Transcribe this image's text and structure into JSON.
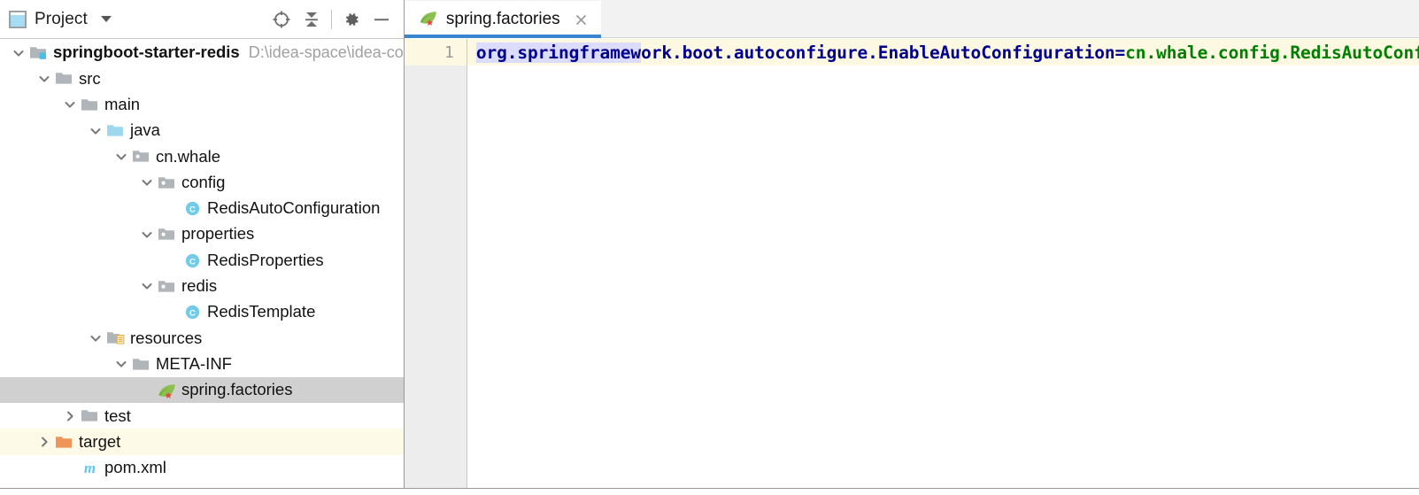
{
  "project_panel": {
    "title": "Project",
    "window_icon": "project-window-icon",
    "dropdown_icon": "chevron-down-icon",
    "actions": [
      {
        "name": "locate-icon",
        "label": "Select Opened File"
      },
      {
        "name": "collapse-all-icon",
        "label": "Collapse All"
      },
      {
        "name": "gear-icon",
        "label": "Settings"
      },
      {
        "name": "minimize-icon",
        "label": "Hide"
      }
    ],
    "tree": [
      {
        "label": "springboot-starter-redis",
        "path": "D:\\idea-space\\idea-co",
        "icon": "module-folder-icon",
        "indent": 0,
        "expanded": true,
        "bold": true,
        "state": "normal"
      },
      {
        "label": "src",
        "path": "",
        "icon": "folder-icon",
        "indent": 1,
        "expanded": true,
        "bold": false,
        "state": "normal"
      },
      {
        "label": "main",
        "path": "",
        "icon": "folder-icon",
        "indent": 2,
        "expanded": true,
        "bold": false,
        "state": "normal"
      },
      {
        "label": "java",
        "path": "",
        "icon": "source-folder-icon",
        "indent": 3,
        "expanded": true,
        "bold": false,
        "state": "normal"
      },
      {
        "label": "cn.whale",
        "path": "",
        "icon": "package-icon",
        "indent": 4,
        "expanded": true,
        "bold": false,
        "state": "normal"
      },
      {
        "label": "config",
        "path": "",
        "icon": "package-icon",
        "indent": 5,
        "expanded": true,
        "bold": false,
        "state": "normal"
      },
      {
        "label": "RedisAutoConfiguration",
        "path": "",
        "icon": "java-class-icon",
        "indent": 6,
        "expanded": null,
        "bold": false,
        "state": "normal"
      },
      {
        "label": "properties",
        "path": "",
        "icon": "package-icon",
        "indent": 5,
        "expanded": true,
        "bold": false,
        "state": "normal"
      },
      {
        "label": "RedisProperties",
        "path": "",
        "icon": "java-class-icon",
        "indent": 6,
        "expanded": null,
        "bold": false,
        "state": "normal"
      },
      {
        "label": "redis",
        "path": "",
        "icon": "package-icon",
        "indent": 5,
        "expanded": true,
        "bold": false,
        "state": "normal"
      },
      {
        "label": "RedisTemplate",
        "path": "",
        "icon": "java-class-icon",
        "indent": 6,
        "expanded": null,
        "bold": false,
        "state": "normal"
      },
      {
        "label": "resources",
        "path": "",
        "icon": "resources-folder-icon",
        "indent": 3,
        "expanded": true,
        "bold": false,
        "state": "normal"
      },
      {
        "label": "META-INF",
        "path": "",
        "icon": "folder-icon",
        "indent": 4,
        "expanded": true,
        "bold": false,
        "state": "normal"
      },
      {
        "label": "spring.factories",
        "path": "",
        "icon": "spring-leaf-icon",
        "indent": 5,
        "expanded": null,
        "bold": false,
        "state": "selected"
      },
      {
        "label": "test",
        "path": "",
        "icon": "folder-icon",
        "indent": 2,
        "expanded": false,
        "bold": false,
        "state": "normal"
      },
      {
        "label": "target",
        "path": "",
        "icon": "excluded-folder-icon",
        "indent": 1,
        "expanded": false,
        "bold": false,
        "state": "tinted"
      },
      {
        "label": "pom.xml",
        "path": "",
        "icon": "maven-icon",
        "indent": 2,
        "expanded": null,
        "bold": false,
        "state": "normal"
      }
    ]
  },
  "editor": {
    "tabs": [
      {
        "label": "spring.factories",
        "icon": "spring-leaf-icon",
        "active": true,
        "close_icon": "close-icon"
      }
    ],
    "line_numbers": [
      "1"
    ],
    "code": {
      "key_selected": "org.springframew",
      "key_rest": "ork.boot.autoconfigure.EnableAutoConfiguration",
      "equals": "=",
      "value": "cn.whale.config.RedisAutoConfiguration"
    }
  },
  "colors": {
    "accent": "#3a85d0",
    "code_key": "#00008f",
    "code_value": "#008000",
    "current_line": "#fdf8e1",
    "selection": "#dcdcff",
    "row_selected": "#d0d0d0",
    "row_tinted": "#fdfbe8",
    "source_folder": "#9ed8f0",
    "excluded_folder": "#f0955a"
  }
}
